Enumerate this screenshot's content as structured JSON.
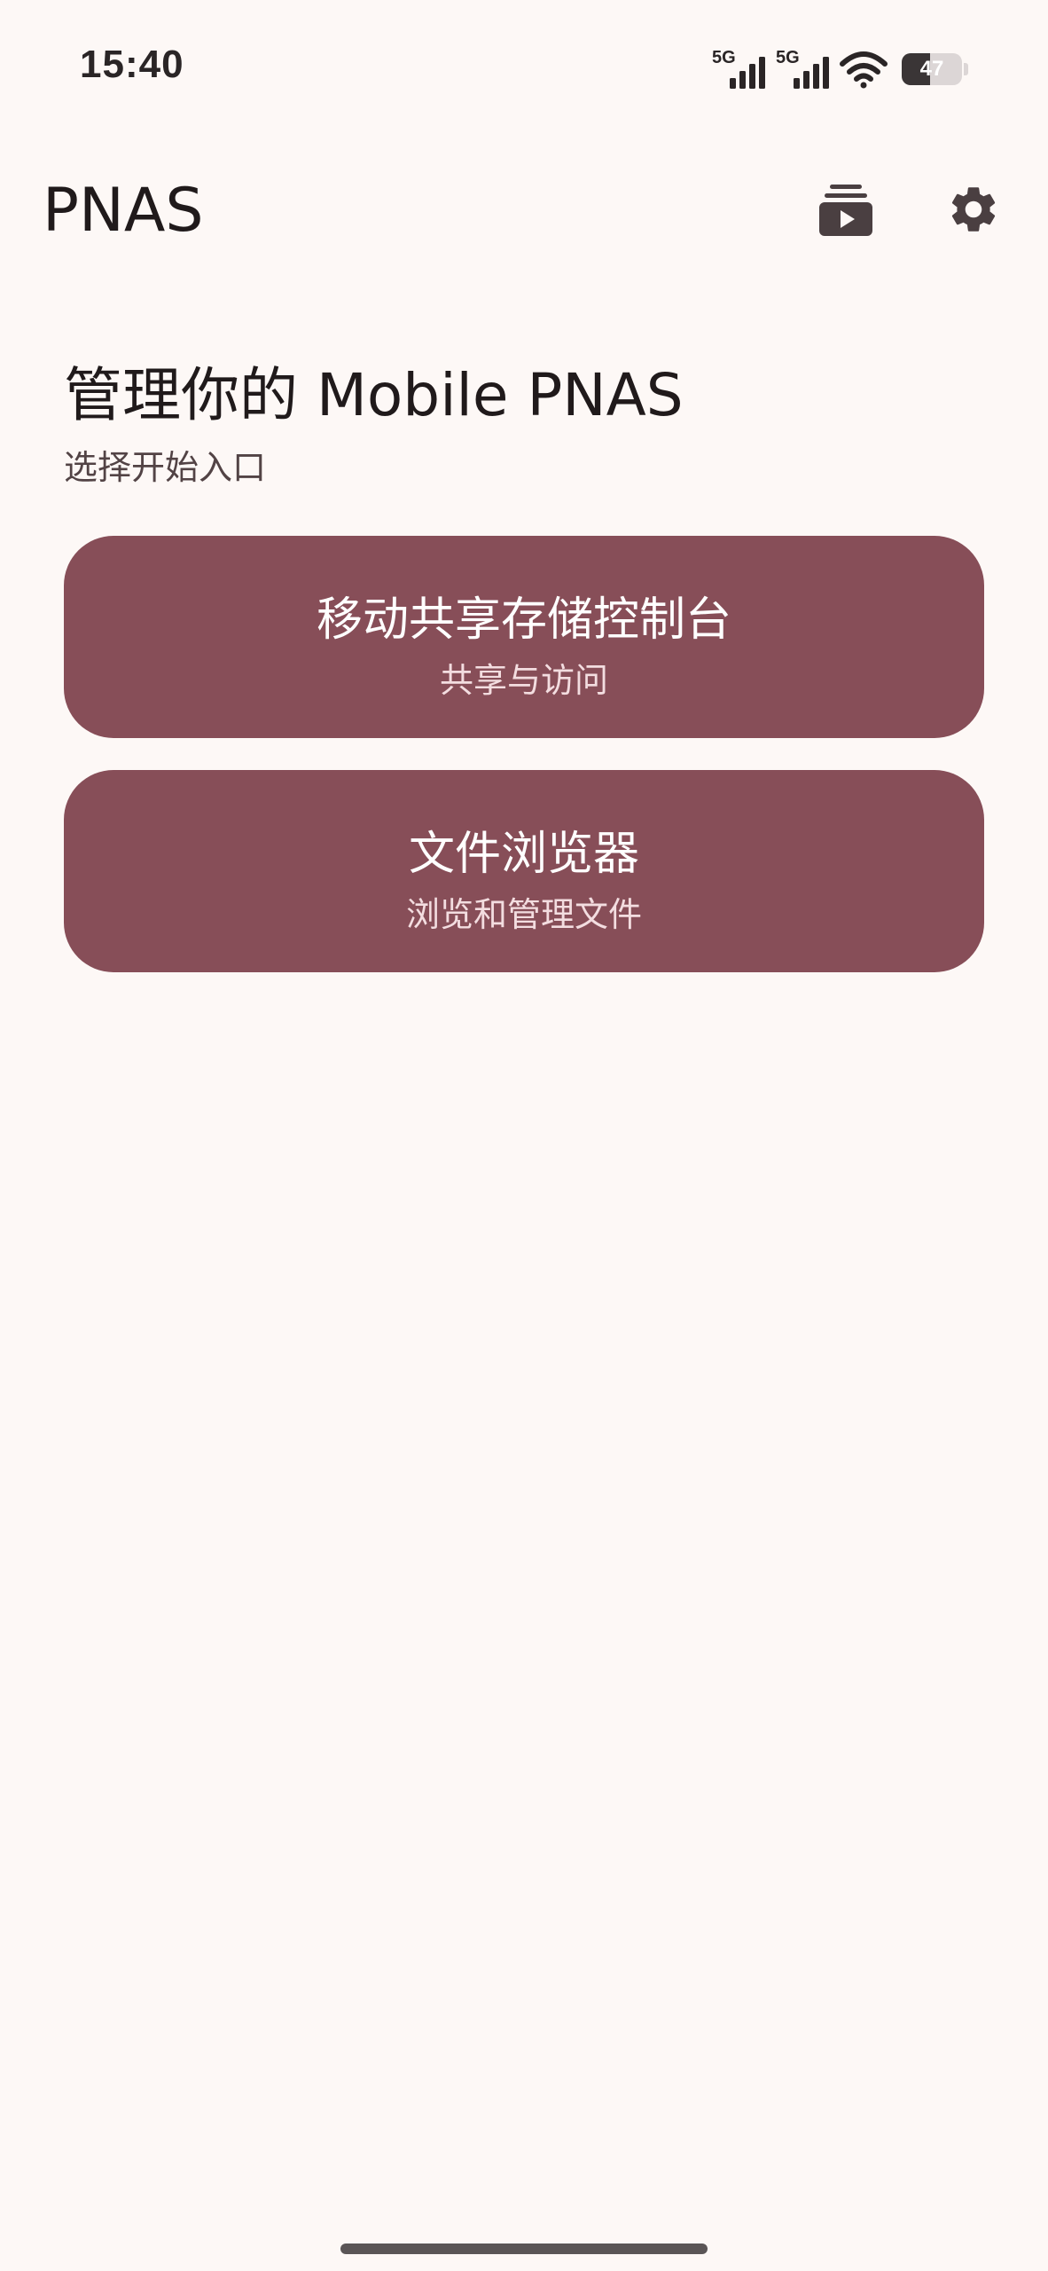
{
  "status_bar": {
    "time": "15:40",
    "network_1": "5G",
    "network_2": "5G",
    "battery_percent": 47,
    "battery_label": "47"
  },
  "app_bar": {
    "title": "PNAS",
    "icons": [
      "media-library-icon",
      "settings-gear-icon"
    ]
  },
  "main": {
    "heading": "管理你的 Mobile PNAS",
    "subheading": "选择开始入口",
    "cards": [
      {
        "title": "移动共享存储控制台",
        "subtitle": "共享与访问"
      },
      {
        "title": "文件浏览器",
        "subtitle": "浏览和管理文件"
      }
    ]
  },
  "colors": {
    "background": "#FDF8F6",
    "card": "#874E58",
    "text": "#201A1B",
    "icon": "#4A3F41"
  }
}
